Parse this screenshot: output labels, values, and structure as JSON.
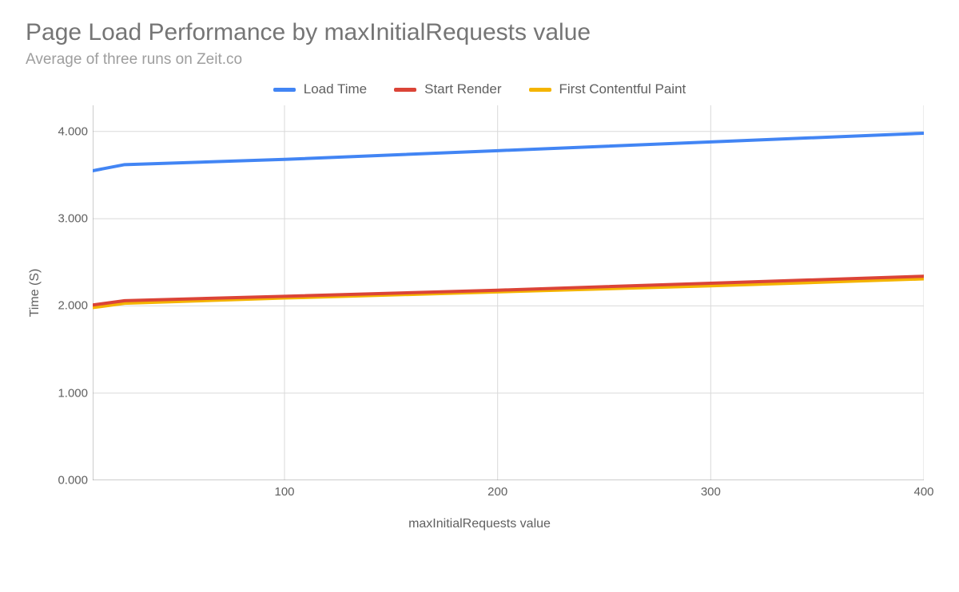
{
  "title": "Page Load Performance by maxInitialRequests value",
  "subtitle": "Average of three runs on Zeit.co",
  "legend": {
    "items": [
      {
        "label": "Load Time",
        "color": "#4285F4"
      },
      {
        "label": "Start Render",
        "color": "#DB4437"
      },
      {
        "label": "First Contentful Paint",
        "color": "#F4B400"
      }
    ]
  },
  "axes": {
    "x": {
      "title": "maxInitialRequests value",
      "ticks": [
        "100",
        "200",
        "300",
        "400"
      ]
    },
    "y": {
      "title": "Time (S)",
      "ticks": [
        "0.000",
        "1.000",
        "2.000",
        "3.000",
        "4.000"
      ]
    }
  },
  "chart_data": {
    "type": "line",
    "title": "Page Load Performance by maxInitialRequests value",
    "subtitle": "Average of three runs on Zeit.co",
    "xlabel": "maxInitialRequests value",
    "ylabel": "Time (S)",
    "xlim": [
      10,
      400
    ],
    "ylim": [
      0,
      4.3
    ],
    "grid": true,
    "legend_position": "top",
    "x": [
      10,
      25,
      100,
      200,
      300,
      400
    ],
    "series": [
      {
        "name": "Load Time",
        "color": "#4285F4",
        "values": [
          3.55,
          3.62,
          3.68,
          3.78,
          3.88,
          3.98
        ]
      },
      {
        "name": "Start Render",
        "color": "#DB4437",
        "values": [
          2.01,
          2.06,
          2.11,
          2.18,
          2.26,
          2.34
        ]
      },
      {
        "name": "First Contentful Paint",
        "color": "#F4B400",
        "values": [
          1.98,
          2.03,
          2.09,
          2.16,
          2.23,
          2.31
        ]
      }
    ]
  }
}
